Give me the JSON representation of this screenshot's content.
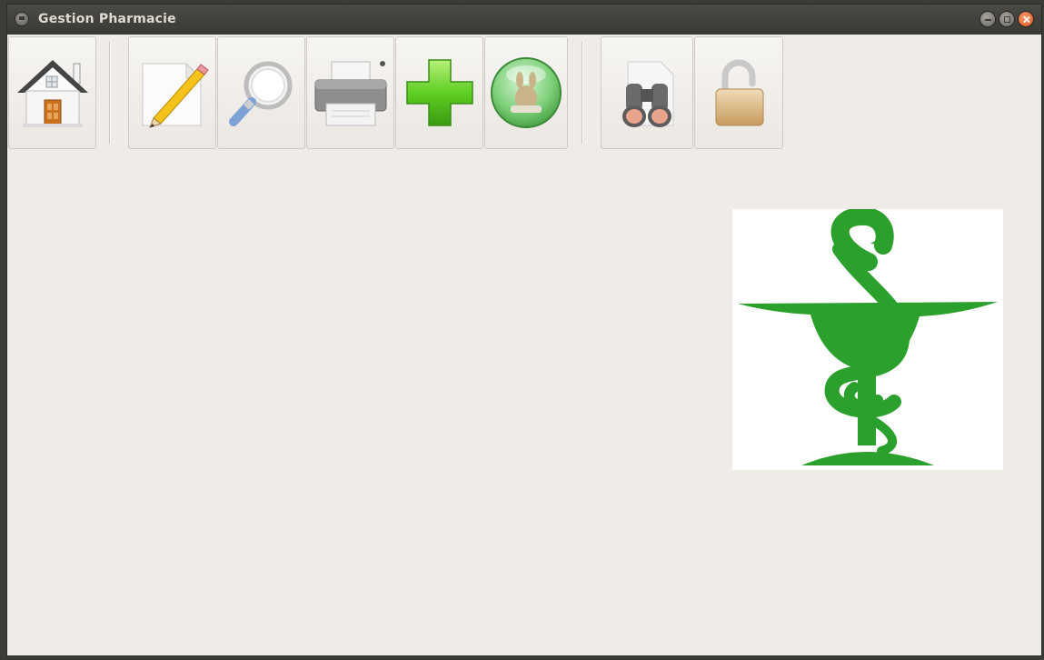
{
  "window": {
    "title": "Gestion Pharmacie"
  },
  "toolbar": {
    "buttons": [
      {
        "id": "home",
        "icon": "house-icon"
      },
      {
        "id": "edit",
        "icon": "pencil-document-icon"
      },
      {
        "id": "search",
        "icon": "magnifier-icon"
      },
      {
        "id": "print",
        "icon": "printer-icon"
      },
      {
        "id": "add",
        "icon": "green-plus-icon"
      },
      {
        "id": "app",
        "icon": "green-orb-icon"
      },
      {
        "id": "find",
        "icon": "binoculars-icon"
      },
      {
        "id": "lock",
        "icon": "padlock-icon"
      }
    ]
  },
  "colors": {
    "titlebar": "#3c3b37",
    "window_bg": "#efebe7",
    "pharmacy_green": "#2ca02c",
    "close_button": "#e0531d"
  }
}
